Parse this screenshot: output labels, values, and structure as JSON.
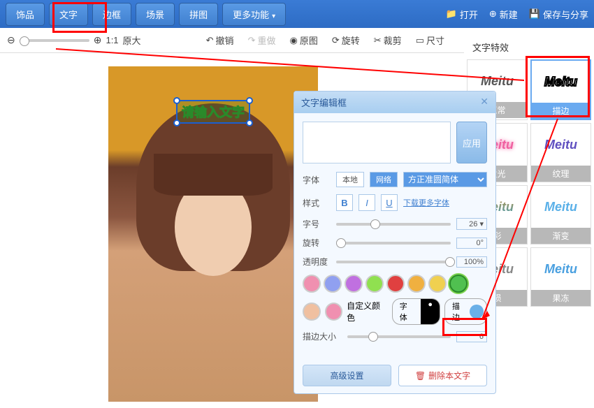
{
  "tabs": [
    "饰品",
    "文字",
    "边框",
    "场景",
    "拼图",
    "更多功能"
  ],
  "top_right": {
    "open": "打开",
    "new": "新建",
    "save": "保存与分享"
  },
  "toolbar": {
    "ratio": "1:1",
    "original_size": "原大",
    "undo": "撤销",
    "redo": "重做",
    "orig_img": "原图",
    "rotate": "旋转",
    "crop": "裁剪",
    "size": "尺寸"
  },
  "canvas": {
    "text_placeholder": "请输入文字"
  },
  "panel": {
    "title": "文字编辑框",
    "apply": "应用",
    "font_label": "字体",
    "font_local": "本地",
    "font_net": "网络",
    "font_name": "方正准圆简体",
    "style_label": "样式",
    "more_fonts": "下载更多字体",
    "size_label": "字号",
    "size_val": "26",
    "rotate_label": "旋转",
    "rotate_val": "0°",
    "opacity_label": "透明度",
    "opacity_val": "100%",
    "custom_color": "自定义颜色",
    "font_pill": "字体",
    "stroke_pill": "描边",
    "stroke_size": "描边大小",
    "stroke_val": "6",
    "advanced": "高级设置",
    "delete": "删除本文字"
  },
  "effects": {
    "title": "文字特效",
    "items": [
      {
        "label": "正常",
        "text": "Meitu",
        "style": "color:#555"
      },
      {
        "label": "描边",
        "text": "Meitu",
        "style": "color:#fff;-webkit-text-stroke:2px #000"
      },
      {
        "label": "发光",
        "text": "Meitu",
        "style": "color:#f060a0;text-shadow:0 0 6px #f060a0"
      },
      {
        "label": "纹理",
        "text": "Meitu",
        "style": "color:#6050c0"
      },
      {
        "label": "彩",
        "text": "Meitu",
        "style": "background:linear-gradient(#f80,#0af);-webkit-background-clip:text;color:transparent"
      },
      {
        "label": "渐变",
        "text": "Meitu",
        "style": "color:#5ab0e8"
      },
      {
        "label": "损",
        "text": "Meitu",
        "style": "color:#888"
      },
      {
        "label": "果冻",
        "text": "Meitu",
        "style": "color:#4aa0e0;text-shadow:1px 1px 0 #fff"
      }
    ]
  },
  "colors": [
    "#f090b0",
    "#90a0f0",
    "#c070e0",
    "#90e050",
    "#e04040",
    "#f0b040",
    "#f0d050",
    "#50c050"
  ],
  "custom_colors": [
    "#f0c0a0",
    "#f090b0"
  ],
  "stroke_swatch": "#6ab0e8"
}
